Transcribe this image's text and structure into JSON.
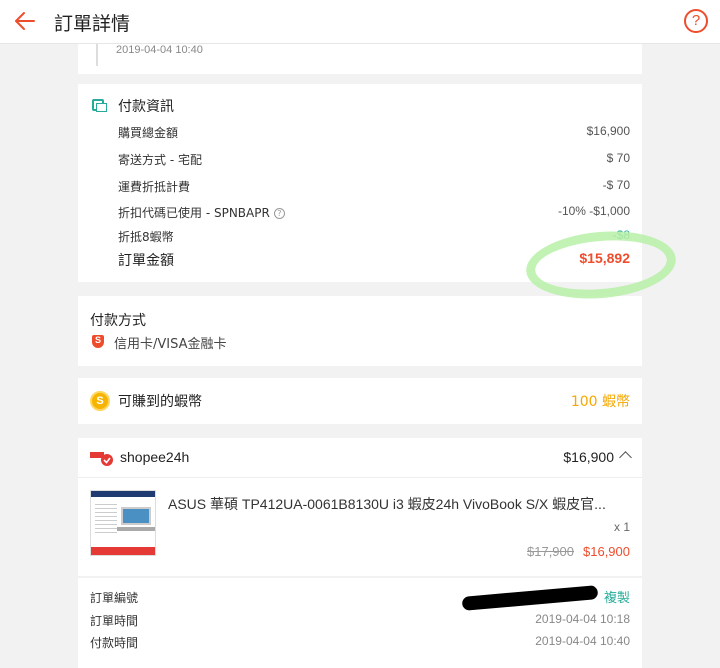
{
  "header": {
    "title": "訂單詳情",
    "help_symbol": "?"
  },
  "timeline": {
    "timestamp": "2019-04-04 10:40"
  },
  "payment_info": {
    "title": "付款資訊",
    "rows": [
      {
        "label": "購買總金額",
        "value": "$16,900"
      },
      {
        "label": "寄送方式 - 宅配",
        "value": "$ 70"
      },
      {
        "label": "運費折抵計費",
        "value": "-$ 70"
      },
      {
        "label": "折扣代碼已使用 - SPNBAPR",
        "value": "-10% -$1,000"
      },
      {
        "label": "折抵8蝦幣",
        "value": "-$8"
      }
    ],
    "total_label": "訂單金額",
    "total_value": "$15,892"
  },
  "payment_method": {
    "title": "付款方式",
    "value": "信用卡/VISA金融卡"
  },
  "coins": {
    "label": "可賺到的蝦幣",
    "value": "100 蝦幣"
  },
  "shop": {
    "name": "shopee24h",
    "total": "$16,900",
    "product": {
      "name": "ASUS 華碩 TP412UA-0061B8130U i3 蝦皮24h VivoBook S/X 蝦皮官...",
      "qty": "x 1",
      "old_price": "$17,900",
      "price": "$16,900"
    }
  },
  "order_meta": {
    "order_no_label": "訂單編號",
    "copy_label": "複製",
    "order_time_label": "訂單時間",
    "order_time": "2019-04-04 10:18",
    "pay_time_label": "付款時間",
    "pay_time": "2019-04-04 10:40"
  },
  "colors": {
    "brand": "#ee4d2d",
    "accent": "#26aa99",
    "coin": "#f6a700"
  }
}
